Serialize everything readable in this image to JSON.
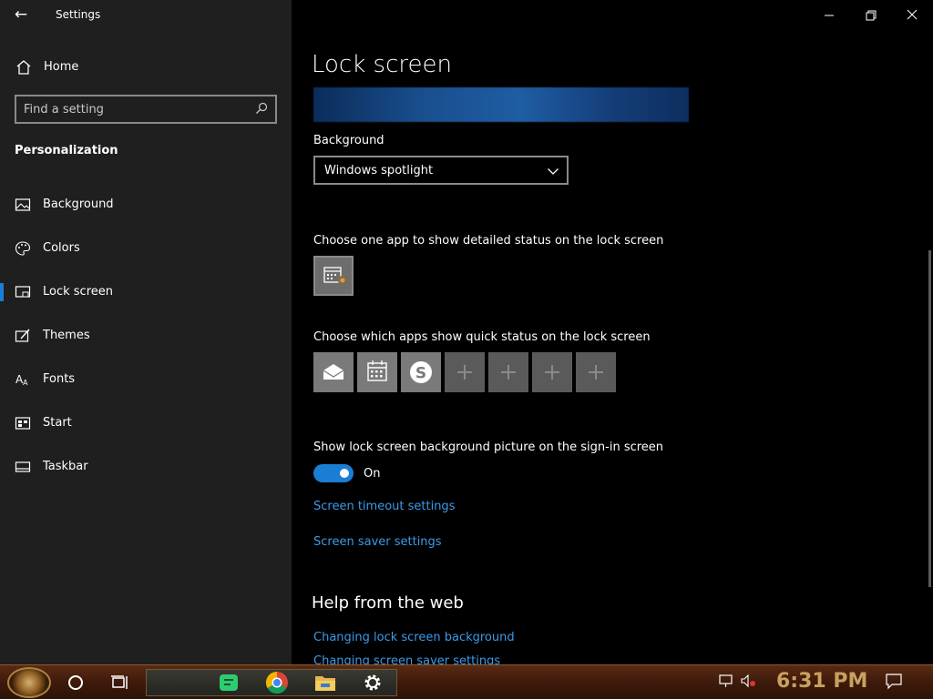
{
  "window": {
    "title": "Settings",
    "back_glyph": "←",
    "controls": {
      "minimize": "—",
      "restore": "❐",
      "close": "✕"
    }
  },
  "sidebar": {
    "home_label": "Home",
    "search_placeholder": "Find a setting",
    "section_title": "Personalization",
    "items": [
      {
        "label": "Background",
        "icon": "image-icon"
      },
      {
        "label": "Colors",
        "icon": "palette-icon"
      },
      {
        "label": "Lock screen",
        "icon": "lock-screen-icon",
        "active": true
      },
      {
        "label": "Themes",
        "icon": "themes-icon"
      },
      {
        "label": "Fonts",
        "icon": "fonts-icon"
      },
      {
        "label": "Start",
        "icon": "start-icon"
      },
      {
        "label": "Taskbar",
        "icon": "taskbar-icon"
      }
    ]
  },
  "main": {
    "page_title": "Lock screen",
    "background_label": "Background",
    "background_value": "Windows spotlight",
    "detailed_status_label": "Choose one app to show detailed status on the lock screen",
    "quick_status_label": "Choose which apps show quick status on the lock screen",
    "quick_status_apps": [
      "mail-icon",
      "calendar-icon",
      "skype-icon",
      "plus-icon",
      "plus-icon",
      "plus-icon",
      "plus-icon"
    ],
    "signin_label": "Show lock screen background picture on the sign-in screen",
    "toggle_state": "On",
    "links": {
      "timeout": "Screen timeout settings",
      "saver": "Screen saver settings"
    },
    "help_title": "Help from the web",
    "help_links": [
      "Changing lock screen background",
      "Changing screen saver settings"
    ]
  },
  "taskbar": {
    "clock": "6:31 PM",
    "colors": {
      "accent": "#1a7fd4",
      "clock": "#c8a060"
    }
  }
}
